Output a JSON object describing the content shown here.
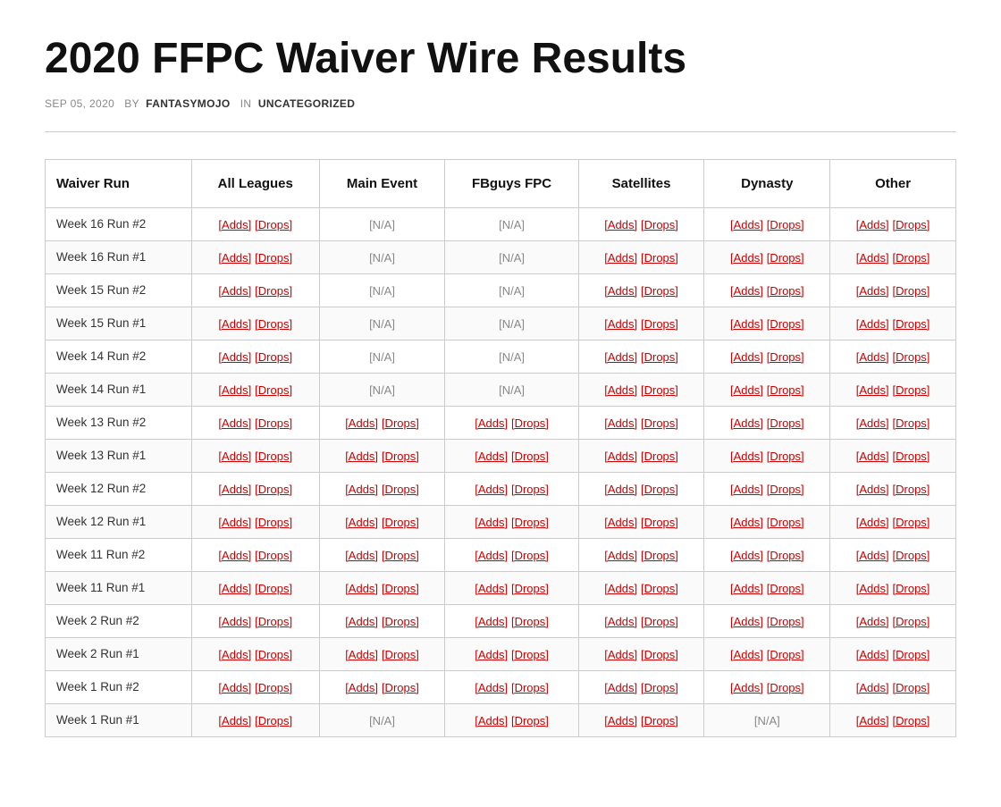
{
  "page": {
    "title": "2020 FFPC Waiver Wire Results",
    "meta": {
      "date": "SEP 05, 2020",
      "by_label": "by",
      "author": "FANTASYMOJO",
      "in_label": "in",
      "category": "UNCATEGORIZED"
    }
  },
  "table": {
    "headers": [
      "Waiver Run",
      "All Leagues",
      "Main Event",
      "FBguys FPC",
      "Satellites",
      "Dynasty",
      "Other"
    ],
    "rows": [
      {
        "label": "Week 16 Run #2",
        "all_leagues": {
          "adds": "[Adds]",
          "drops": "[Drops]"
        },
        "main_event": {
          "na": "[N/A]"
        },
        "fbguys": {
          "na": "[N/A]"
        },
        "satellites": {
          "adds": "[Adds]",
          "drops": "[Drops]"
        },
        "dynasty": {
          "adds": "[Adds]",
          "drops": "[Drops]"
        },
        "other": {
          "adds": "[Adds]",
          "drops": "[Drops]"
        }
      },
      {
        "label": "Week 16 Run #1",
        "all_leagues": {
          "adds": "[Adds]",
          "drops": "[Drops]"
        },
        "main_event": {
          "na": "[N/A]"
        },
        "fbguys": {
          "na": "[N/A]"
        },
        "satellites": {
          "adds": "[Adds]",
          "drops": "[Drops]"
        },
        "dynasty": {
          "adds": "[Adds]",
          "drops": "[Drops]"
        },
        "other": {
          "adds": "[Adds]",
          "drops": "[Drops]"
        }
      },
      {
        "label": "Week 15 Run #2",
        "all_leagues": {
          "adds": "[Adds]",
          "drops": "[Drops]"
        },
        "main_event": {
          "na": "[N/A]"
        },
        "fbguys": {
          "na": "[N/A]"
        },
        "satellites": {
          "adds": "[Adds]",
          "drops": "[Drops]"
        },
        "dynasty": {
          "adds": "[Adds]",
          "drops": "[Drops]"
        },
        "other": {
          "adds": "[Adds]",
          "drops": "[Drops]"
        }
      },
      {
        "label": "Week 15 Run #1",
        "all_leagues": {
          "adds": "[Adds]",
          "drops": "[Drops]"
        },
        "main_event": {
          "na": "[N/A]"
        },
        "fbguys": {
          "na": "[N/A]"
        },
        "satellites": {
          "adds": "[Adds]",
          "drops": "[Drops]"
        },
        "dynasty": {
          "adds": "[Adds]",
          "drops": "[Drops]"
        },
        "other": {
          "adds": "[Adds]",
          "drops": "[Drops]"
        }
      },
      {
        "label": "Week 14 Run #2",
        "all_leagues": {
          "adds": "[Adds]",
          "drops": "[Drops]"
        },
        "main_event": {
          "na": "[N/A]"
        },
        "fbguys": {
          "na": "[N/A]"
        },
        "satellites": {
          "adds": "[Adds]",
          "drops": "[Drops]"
        },
        "dynasty": {
          "adds": "[Adds]",
          "drops": "[Drops]"
        },
        "other": {
          "adds": "[Adds]",
          "drops": "[Drops]"
        }
      },
      {
        "label": "Week 14 Run #1",
        "all_leagues": {
          "adds": "[Adds]",
          "drops": "[Drops]"
        },
        "main_event": {
          "na": "[N/A]"
        },
        "fbguys": {
          "na": "[N/A]"
        },
        "satellites": {
          "adds": "[Adds]",
          "drops": "[Drops]"
        },
        "dynasty": {
          "adds": "[Adds]",
          "drops": "[Drops]"
        },
        "other": {
          "adds": "[Adds]",
          "drops": "[Drops]"
        }
      },
      {
        "label": "Week 13 Run #2",
        "all_leagues": {
          "adds": "[Adds]",
          "drops": "[Drops]"
        },
        "main_event": {
          "adds": "[Adds]",
          "drops": "[Drops]"
        },
        "fbguys": {
          "adds": "[Adds]",
          "drops": "[Drops]"
        },
        "satellites": {
          "adds": "[Adds]",
          "drops": "[Drops]"
        },
        "dynasty": {
          "adds": "[Adds]",
          "drops": "[Drops]"
        },
        "other": {
          "adds": "[Adds]",
          "drops": "[Drops]"
        }
      },
      {
        "label": "Week 13 Run #1",
        "all_leagues": {
          "adds": "[Adds]",
          "drops": "[Drops]"
        },
        "main_event": {
          "adds": "[Adds]",
          "drops": "[Drops]"
        },
        "fbguys": {
          "adds": "[Adds]",
          "drops": "[Drops]"
        },
        "satellites": {
          "adds": "[Adds]",
          "drops": "[Drops]"
        },
        "dynasty": {
          "adds": "[Adds]",
          "drops": "[Drops]"
        },
        "other": {
          "adds": "[Adds]",
          "drops": "[Drops]"
        }
      },
      {
        "label": "Week 12 Run #2",
        "all_leagues": {
          "adds": "[Adds]",
          "drops": "[Drops]"
        },
        "main_event": {
          "adds": "[Adds]",
          "drops": "[Drops]"
        },
        "fbguys": {
          "adds": "[Adds]",
          "drops": "[Drops]"
        },
        "satellites": {
          "adds": "[Adds]",
          "drops": "[Drops]"
        },
        "dynasty": {
          "adds": "[Adds]",
          "drops": "[Drops]"
        },
        "other": {
          "adds": "[Adds]",
          "drops": "[Drops]"
        }
      },
      {
        "label": "Week 12 Run #1",
        "all_leagues": {
          "adds": "[Adds]",
          "drops": "[Drops]"
        },
        "main_event": {
          "adds": "[Adds]",
          "drops": "[Drops]"
        },
        "fbguys": {
          "adds": "[Adds]",
          "drops": "[Drops]"
        },
        "satellites": {
          "adds": "[Adds]",
          "drops": "[Drops]"
        },
        "dynasty": {
          "adds": "[Adds]",
          "drops": "[Drops]"
        },
        "other": {
          "adds": "[Adds]",
          "drops": "[Drops]"
        }
      },
      {
        "label": "Week 11 Run #2",
        "all_leagues": {
          "adds": "[Adds]",
          "drops": "[Drops]"
        },
        "main_event": {
          "adds": "[Adds]",
          "drops": "[Drops]"
        },
        "fbguys": {
          "adds": "[Adds]",
          "drops": "[Drops]"
        },
        "satellites": {
          "adds": "[Adds]",
          "drops": "[Drops]"
        },
        "dynasty": {
          "adds": "[Adds]",
          "drops": "[Drops]"
        },
        "other": {
          "adds": "[Adds]",
          "drops": "[Drops]"
        }
      },
      {
        "label": "Week 11 Run #1",
        "all_leagues": {
          "adds": "[Adds]",
          "drops": "[Drops]"
        },
        "main_event": {
          "adds": "[Adds]",
          "drops": "[Drops]"
        },
        "fbguys": {
          "adds": "[Adds]",
          "drops": "[Drops]"
        },
        "satellites": {
          "adds": "[Adds]",
          "drops": "[Drops]"
        },
        "dynasty": {
          "adds": "[Adds]",
          "drops": "[Drops]"
        },
        "other": {
          "adds": "[Adds]",
          "drops": "[Drops]"
        }
      },
      {
        "label": "Week 2 Run #2",
        "all_leagues": {
          "adds": "[Adds]",
          "drops": "[Drops]"
        },
        "main_event": {
          "adds": "[Adds]",
          "drops": "[Drops]"
        },
        "fbguys": {
          "adds": "[Adds]",
          "drops": "[Drops]"
        },
        "satellites": {
          "adds": "[Adds]",
          "drops": "[Drops]"
        },
        "dynasty": {
          "adds": "[Adds]",
          "drops": "[Drops]"
        },
        "other": {
          "adds": "[Adds]",
          "drops": "[Drops]"
        }
      },
      {
        "label": "Week 2 Run #1",
        "all_leagues": {
          "adds": "[Adds]",
          "drops": "[Drops]"
        },
        "main_event": {
          "adds": "[Adds]",
          "drops": "[Drops]"
        },
        "fbguys": {
          "adds": "[Adds]",
          "drops": "[Drops]"
        },
        "satellites": {
          "adds": "[Adds]",
          "drops": "[Drops]"
        },
        "dynasty": {
          "adds": "[Adds]",
          "drops": "[Drops]"
        },
        "other": {
          "adds": "[Adds]",
          "drops": "[Drops]"
        }
      },
      {
        "label": "Week 1 Run #2",
        "all_leagues": {
          "adds": "[Adds]",
          "drops": "[Drops]"
        },
        "main_event": {
          "adds": "[Adds]",
          "drops": "[Drops]"
        },
        "fbguys": {
          "adds": "[Adds]",
          "drops": "[Drops]"
        },
        "satellites": {
          "adds": "[Adds]",
          "drops": "[Drops]"
        },
        "dynasty": {
          "adds": "[Adds]",
          "drops": "[Drops]"
        },
        "other": {
          "adds": "[Adds]",
          "drops": "[Drops]"
        }
      },
      {
        "label": "Week 1 Run #1",
        "all_leagues": {
          "adds": "[Adds]",
          "drops": "[Drops]"
        },
        "main_event": {
          "na": "[N/A]"
        },
        "fbguys": {
          "adds": "[Adds]",
          "drops": "[Drops]"
        },
        "satellites": {
          "adds": "[Adds]",
          "drops": "[Drops]"
        },
        "dynasty": {
          "na": "[N/A]"
        },
        "other": {
          "adds": "[Adds]",
          "drops": "[Drops]"
        }
      }
    ]
  }
}
